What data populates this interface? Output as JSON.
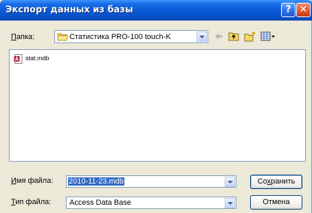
{
  "window": {
    "title": "Экспорт данных из базы",
    "help_label": "?",
    "close_label": "✕"
  },
  "folder": {
    "label_underlined": "П",
    "label_rest": "апка:",
    "value": "Статистика PRO-100 touch-K"
  },
  "toolbar": {
    "icons": [
      "back-arrow-icon",
      "up-folder-icon",
      "new-folder-icon",
      "view-menu-icon"
    ]
  },
  "files": [
    {
      "name": "stat.mdb",
      "icon": "access-db-icon"
    }
  ],
  "filename": {
    "label_underlined": "И",
    "label_rest": "мя файла:",
    "value": "2010-11-23.mdb"
  },
  "filetype": {
    "label_underlined": "Т",
    "label_rest": "ип файла:",
    "value": "Access Data Base"
  },
  "buttons": {
    "save_pre": "Со",
    "save_underlined": "х",
    "save_post": "ранить",
    "cancel": "Отмена"
  },
  "colors": {
    "titlebar": "#0a5ad8",
    "selection": "#316ac5",
    "dialog_bg": "#ece9d8"
  }
}
